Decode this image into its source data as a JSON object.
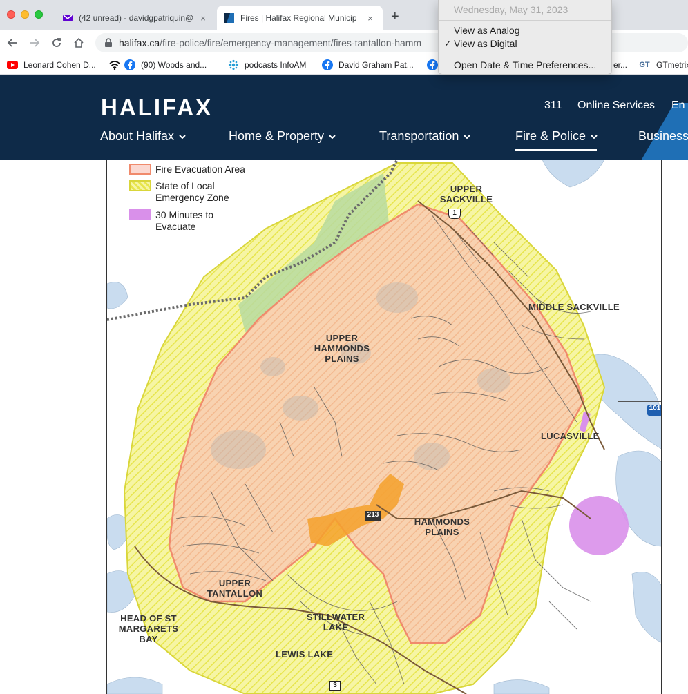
{
  "browser": {
    "tabs": [
      {
        "title": "(42 unread) - davidgpatriquin@",
        "close": "×"
      },
      {
        "title": "Fires | Halifax Regional Municip",
        "close": "×"
      }
    ],
    "new_tab": "+",
    "url_host": "halifax.ca",
    "url_path": "/fire-police/fire/emergency-management/fires-tantallon-hamm",
    "bookmarks": [
      {
        "label": "Leonard Cohen D...",
        "icon": "youtube-icon"
      },
      {
        "label": "(90) Woods and...",
        "icon": "facebook-icon"
      },
      {
        "label": "podcasts InfoAM",
        "icon": "cbc-icon"
      },
      {
        "label": "David Graham Pat...",
        "icon": "facebook-icon"
      },
      {
        "label": "er...",
        "icon": "facebook-icon"
      },
      {
        "label": "GTmetrix",
        "icon": "gtmetrix-icon"
      }
    ],
    "gtmetrix_badge": "GT"
  },
  "clock_menu": {
    "date": "Wednesday, May 31, 2023",
    "view_analog": "View as Analog",
    "view_digital": "View as Digital",
    "checkmark": "✓",
    "preferences": "Open Date & Time Preferences..."
  },
  "site": {
    "logo": "HALIFAX",
    "utility_links": [
      "311",
      "Online Services",
      "En"
    ],
    "nav": [
      "About Halifax",
      "Home & Property",
      "Transportation",
      "Fire & Police",
      "Business"
    ],
    "active_nav": "Fire & Police"
  },
  "map": {
    "legend": [
      {
        "label": "Fire Evacuation Area",
        "color": "#f8c9bf"
      },
      {
        "label": "State of Local Emergency Zone",
        "color": "#f3f27a"
      },
      {
        "label": "30 Minutes to Evacuate",
        "color": "#d990ea"
      }
    ],
    "places": [
      "UPPER SACKVILLE",
      "MIDDLE SACKVILLE",
      "UPPER HAMMONDS PLAINS",
      "LUCASVILLE",
      "HAMMONDS PLAINS",
      "UPPER TANTALLON",
      "HEAD OF ST MARGARETS BAY",
      "STILLWATER LAKE",
      "LEWIS LAKE"
    ],
    "highway_shields": [
      "1",
      "101",
      "213",
      "3"
    ],
    "colors": {
      "evacuation_fill": "#f7c7a6",
      "evacuation_edge": "#f08a6c",
      "emergency_fill": "#f4f38f",
      "thirty_min_fill": "#d990ea",
      "burn_area": "#f4a12b",
      "water": "#c9dcef",
      "green": "#b7dba0",
      "header_bg": "#0e2a48"
    }
  }
}
